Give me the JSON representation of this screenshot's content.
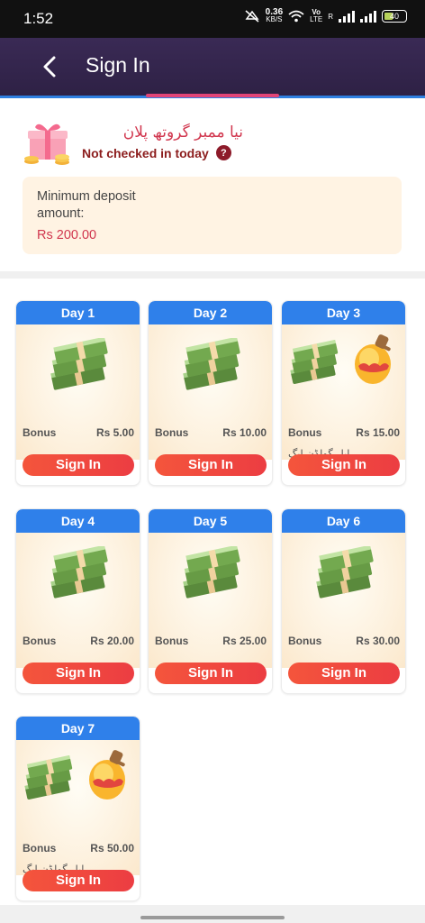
{
  "status_bar": {
    "time": "1:52",
    "net_speed": "0.36",
    "net_unit": "KB/S",
    "volte": "Vo",
    "lte": "LTE",
    "lte2": "R",
    "battery": "40"
  },
  "header": {
    "title": "Sign In",
    "back_icon": "chevron-left-icon"
  },
  "plan": {
    "title": "نیا ممبر گروتھ پلان",
    "status": "Not checked in today",
    "help_icon": "?",
    "deposit_label": "Minimum deposit amount:",
    "deposit_value": "Rs 200.00"
  },
  "days": [
    {
      "label": "Day 1",
      "bonus_label": "Bonus",
      "bonus_value": "Rs 5.00",
      "extra": "",
      "button": "Sign In",
      "has_egg": false
    },
    {
      "label": "Day 2",
      "bonus_label": "Bonus",
      "bonus_value": "Rs 10.00",
      "extra": "",
      "button": "Sign In",
      "has_egg": false
    },
    {
      "label": "Day 3",
      "bonus_label": "Bonus",
      "bonus_value": "Rs 15.00",
      "extra": "ایل گولڈن ایگ",
      "button": "Sign In",
      "has_egg": true
    },
    {
      "label": "Day 4",
      "bonus_label": "Bonus",
      "bonus_value": "Rs 20.00",
      "extra": "",
      "button": "Sign In",
      "has_egg": false
    },
    {
      "label": "Day 5",
      "bonus_label": "Bonus",
      "bonus_value": "Rs 25.00",
      "extra": "",
      "button": "Sign In",
      "has_egg": false
    },
    {
      "label": "Day 6",
      "bonus_label": "Bonus",
      "bonus_value": "Rs 30.00",
      "extra": "",
      "button": "Sign In",
      "has_egg": false
    },
    {
      "label": "Day 7",
      "bonus_label": "Bonus",
      "bonus_value": "Rs 50.00",
      "extra": "ایل گولڈن ایگ",
      "button": "Sign In",
      "has_egg": true
    }
  ],
  "colors": {
    "header_bg": "#2e2145",
    "day_header": "#2f80ea",
    "button": "#ef4640",
    "accent_red": "#d1364e"
  }
}
